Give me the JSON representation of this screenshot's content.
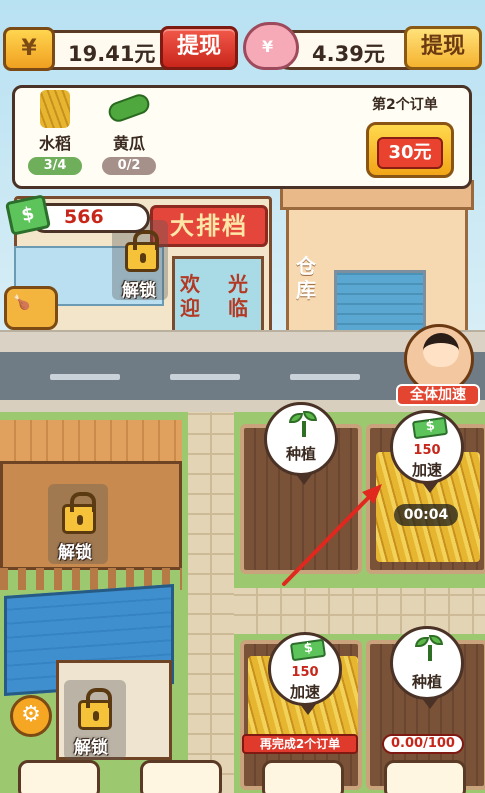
{
  "topbar": {
    "cash_amount": "19.41元",
    "cash_withdraw_label": "提现",
    "piggy_amount": "4.39元",
    "piggy_withdraw_label": "提现",
    "wallet_symbol": "¥",
    "piggy_symbol": "¥"
  },
  "order": {
    "title": "第2个订单",
    "reward": "30元",
    "crops": [
      {
        "name": "水稻",
        "progress": "3/4",
        "color": "#6fae5a"
      },
      {
        "name": "黄瓜",
        "progress": "0/2",
        "color": "#a6918a"
      }
    ]
  },
  "coins": {
    "value": "566"
  },
  "buildings": {
    "shop_sign": "大排档",
    "shop_door_left": "欢迎",
    "shop_door_right": "光临",
    "shop_unlock": "解锁",
    "warehouse_label": "仓库"
  },
  "speed_all_label": "全体加速",
  "plots": [
    {
      "action": "种植"
    },
    {
      "cost": "150",
      "action": "加速",
      "timer": "00:04"
    },
    {
      "cost": "150",
      "action": "加速",
      "banner": "再完成2个订单"
    },
    {
      "action": "种植",
      "progress": "0.00/100"
    }
  ],
  "areas": {
    "barn_unlock": "解锁",
    "shed_unlock": "解锁"
  },
  "colors": {
    "accent_red": "#e03a2c",
    "gold": "#f5b32f",
    "grass": "#9cc870"
  },
  "icons": [
    "wallet-icon",
    "piggy-bank-icon",
    "rice-icon",
    "cucumber-icon",
    "cash-icon",
    "lock-icon",
    "sprout-icon",
    "money-icon",
    "settings-icon",
    "arrow-icon"
  ]
}
